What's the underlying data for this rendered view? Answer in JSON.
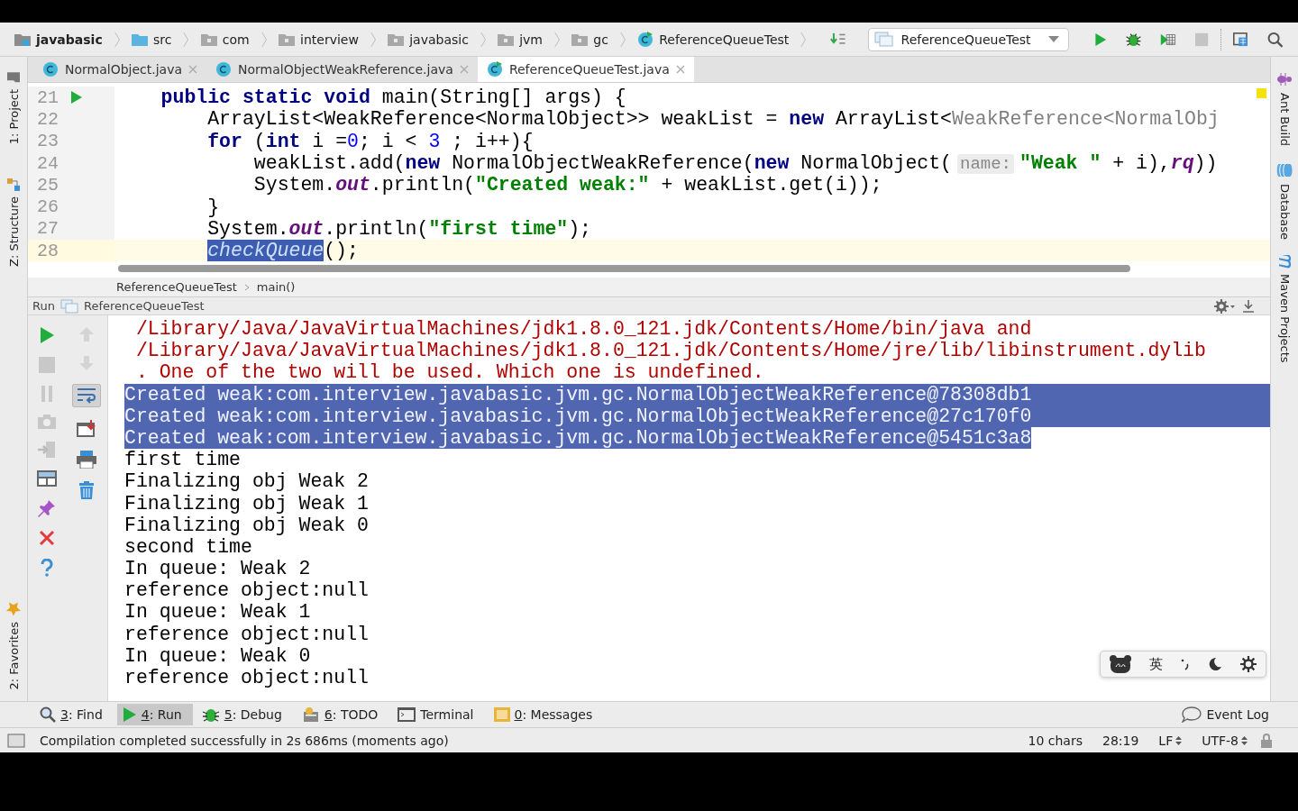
{
  "nav_bar": {
    "breadcrumbs": [
      {
        "label": "javabasic",
        "kind": "module"
      },
      {
        "label": "src",
        "kind": "source"
      },
      {
        "label": "com",
        "kind": "package"
      },
      {
        "label": "interview",
        "kind": "package"
      },
      {
        "label": "javabasic",
        "kind": "package"
      },
      {
        "label": "jvm",
        "kind": "package"
      },
      {
        "label": "gc",
        "kind": "package"
      },
      {
        "label": "ReferenceQueueTest",
        "kind": "class"
      }
    ],
    "run_config": "ReferenceQueueTest"
  },
  "editor_tabs": [
    {
      "label": "NormalObject.java",
      "selected": false
    },
    {
      "label": "NormalObjectWeakReference.java",
      "selected": false
    },
    {
      "label": "ReferenceQueueTest.java",
      "selected": true
    }
  ],
  "left_tool_windows": [
    {
      "label": "1: Project",
      "kind": "project"
    },
    {
      "label": "Z: Structure",
      "kind": "structure"
    },
    {
      "label": "2: Favorites",
      "kind": "favorites"
    }
  ],
  "right_tool_windows": [
    {
      "label": "Ant Build",
      "kind": "ant"
    },
    {
      "label": "Database",
      "kind": "database"
    },
    {
      "label": "Maven Projects",
      "kind": "maven"
    }
  ],
  "editor": {
    "lines": [
      {
        "number": "21",
        "run_marker": true,
        "current": false,
        "segments": [
          {
            "kind": "keyword",
            "text": "    public static void"
          },
          {
            "kind": "plain",
            "text": " main(String[] args) {"
          }
        ]
      },
      {
        "number": "22",
        "run_marker": false,
        "current": false,
        "segments": [
          {
            "kind": "plain",
            "text": "        ArrayList<WeakReference<NormalObject>> weakList = "
          },
          {
            "kind": "keyword",
            "text": "new"
          },
          {
            "kind": "plain",
            "text": " ArrayList<"
          },
          {
            "kind": "faded",
            "text": "WeakReference<NormalObj"
          }
        ]
      },
      {
        "number": "23",
        "run_marker": false,
        "current": false,
        "segments": [
          {
            "kind": "keyword",
            "text": "        for"
          },
          {
            "kind": "plain",
            "text": " ("
          },
          {
            "kind": "keyword",
            "text": "int"
          },
          {
            "kind": "plain",
            "text": " i ="
          },
          {
            "kind": "number",
            "text": "0"
          },
          {
            "kind": "plain",
            "text": "; i < "
          },
          {
            "kind": "number",
            "text": "3"
          },
          {
            "kind": "plain",
            "text": " ; i++){"
          }
        ]
      },
      {
        "number": "24",
        "run_marker": false,
        "current": false,
        "segments": [
          {
            "kind": "plain",
            "text": "            weakList.add("
          },
          {
            "kind": "keyword",
            "text": "new"
          },
          {
            "kind": "plain",
            "text": " NormalObjectWeakReference("
          },
          {
            "kind": "keyword",
            "text": "new"
          },
          {
            "kind": "plain",
            "text": " NormalObject("
          },
          {
            "kind": "hint",
            "text": "name:"
          },
          {
            "kind": "string",
            "text": "\"Weak \""
          },
          {
            "kind": "plain",
            "text": " + i),"
          },
          {
            "kind": "field",
            "text": "rq"
          },
          {
            "kind": "plain",
            "text": "))"
          }
        ]
      },
      {
        "number": "25",
        "run_marker": false,
        "current": false,
        "segments": [
          {
            "kind": "plain",
            "text": "            System."
          },
          {
            "kind": "field",
            "text": "out"
          },
          {
            "kind": "plain",
            "text": ".println("
          },
          {
            "kind": "string",
            "text": "\"Created weak:\""
          },
          {
            "kind": "plain",
            "text": " + weakList.get(i));"
          }
        ]
      },
      {
        "number": "26",
        "run_marker": false,
        "current": false,
        "segments": [
          {
            "kind": "plain",
            "text": "        }"
          }
        ]
      },
      {
        "number": "27",
        "run_marker": false,
        "current": false,
        "segments": [
          {
            "kind": "plain",
            "text": "        System."
          },
          {
            "kind": "field",
            "text": "out"
          },
          {
            "kind": "plain",
            "text": ".println("
          },
          {
            "kind": "string",
            "text": "\"first time\""
          },
          {
            "kind": "plain",
            "text": ");"
          }
        ]
      },
      {
        "number": "28",
        "run_marker": false,
        "current": true,
        "segments": [
          {
            "kind": "selected",
            "text": "checkQueue"
          },
          {
            "kind": "plain",
            "text": "();"
          }
        ]
      }
    ]
  },
  "editor_breadcrumbs": [
    "ReferenceQueueTest",
    "main()"
  ],
  "run_panel": {
    "label": "Run",
    "config": "ReferenceQueueTest",
    "output": [
      {
        "kind": "error",
        "selected": false,
        "text": " /Library/Java/JavaVirtualMachines/jdk1.8.0_121.jdk/Contents/Home/bin/java and"
      },
      {
        "kind": "error",
        "selected": false,
        "text": " /Library/Java/JavaVirtualMachines/jdk1.8.0_121.jdk/Contents/Home/jre/lib/libinstrument.dylib"
      },
      {
        "kind": "error",
        "selected": false,
        "text": " . One of the two will be used. Which one is undefined."
      },
      {
        "kind": "normal",
        "selected": true,
        "text": "Created weak:com.interview.javabasic.jvm.gc.NormalObjectWeakReference@78308db1"
      },
      {
        "kind": "normal",
        "selected": true,
        "text": "Created weak:com.interview.javabasic.jvm.gc.NormalObjectWeakReference@27c170f0"
      },
      {
        "kind": "normal",
        "selected": true,
        "text": "Created weak:com.interview.javabasic.jvm.gc.NormalObjectWeakReference@5451c3a8"
      },
      {
        "kind": "normal",
        "selected": false,
        "text": "first time"
      },
      {
        "kind": "normal",
        "selected": false,
        "text": "Finalizing obj Weak 2"
      },
      {
        "kind": "normal",
        "selected": false,
        "text": "Finalizing obj Weak 1"
      },
      {
        "kind": "normal",
        "selected": false,
        "text": "Finalizing obj Weak 0"
      },
      {
        "kind": "normal",
        "selected": false,
        "text": "second time"
      },
      {
        "kind": "normal",
        "selected": false,
        "text": "In queue: Weak 2"
      },
      {
        "kind": "normal",
        "selected": false,
        "text": "reference object:null"
      },
      {
        "kind": "normal",
        "selected": false,
        "text": "In queue: Weak 1"
      },
      {
        "kind": "normal",
        "selected": false,
        "text": "reference object:null"
      },
      {
        "kind": "normal",
        "selected": false,
        "text": "In queue: Weak 0"
      },
      {
        "kind": "normal",
        "selected": false,
        "text": "reference object:null"
      }
    ]
  },
  "input_method_bar": {
    "language": "英"
  },
  "tool_window_bar": [
    {
      "kind": "find",
      "shortcut": "3",
      "label": ": Find",
      "selected": false
    },
    {
      "kind": "run",
      "shortcut": "4",
      "label": ": Run",
      "selected": true
    },
    {
      "kind": "debug",
      "shortcut": "5",
      "label": ": Debug",
      "selected": false
    },
    {
      "kind": "todo",
      "shortcut": "6",
      "label": ": TODO",
      "selected": false
    },
    {
      "kind": "terminal",
      "label": "Terminal",
      "selected": false
    },
    {
      "kind": "messages",
      "shortcut": "0",
      "label": ": Messages",
      "selected": false
    }
  ],
  "event_log": "Event Log",
  "status_bar": {
    "message": "Compilation completed successfully in 2s 686ms (moments ago)",
    "chars": "10 chars",
    "position": "28:19",
    "line_separator": "LF",
    "encoding": "UTF-8"
  }
}
